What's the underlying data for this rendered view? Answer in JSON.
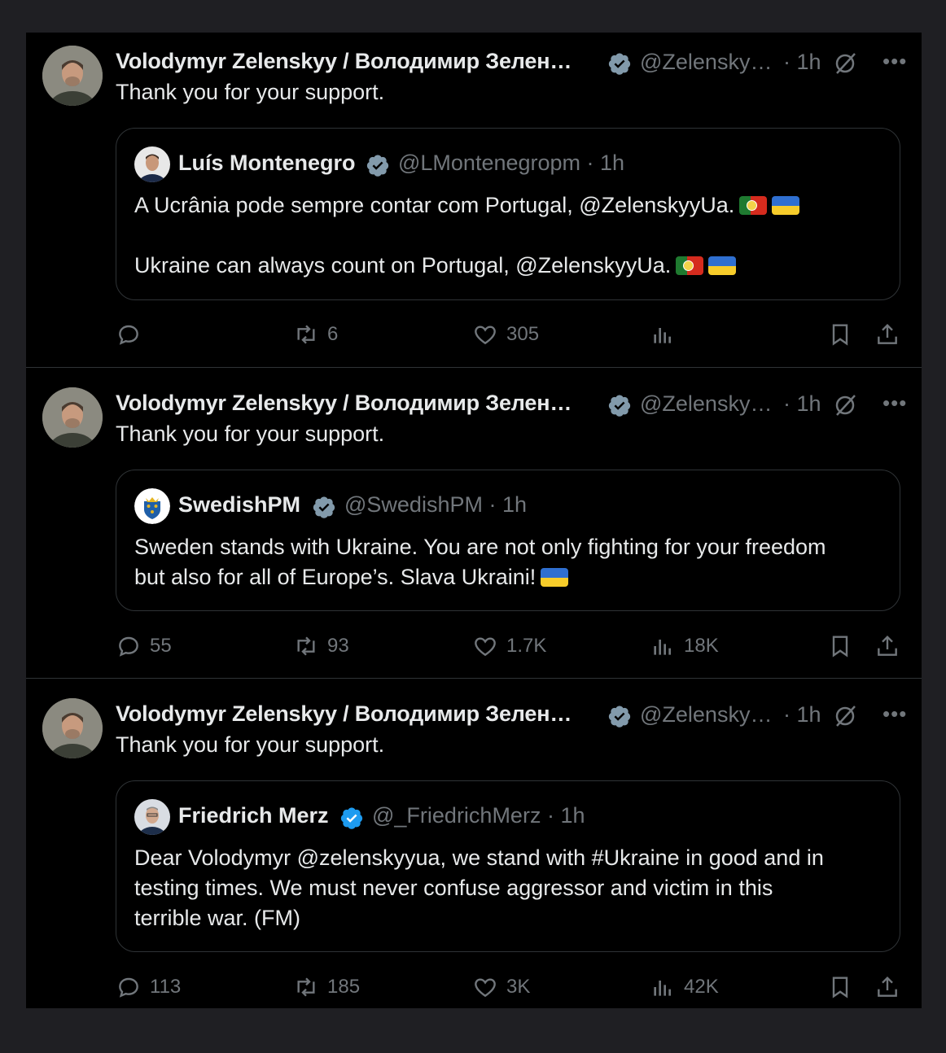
{
  "tweets": [
    {
      "author": "Volodymyr Zelenskyy / Володимир Зелен…",
      "handle": "@Zelensky…",
      "time": "· 1h",
      "more": "•••",
      "text": "Thank you for your support.",
      "quote": {
        "author": "Luís Montenegro",
        "handle": "@LMontenegropm · 1h",
        "verified_color": "#829aab",
        "lines": [
          "A Ucrânia pode sempre contar com Portugal, @ZelenskyyUa.",
          "",
          "Ukraine can always count on Portugal, @ZelenskyyUa."
        ]
      },
      "actions": {
        "replies": "",
        "reposts": "6",
        "likes": "305",
        "views": ""
      }
    },
    {
      "author": "Volodymyr Zelenskyy / Володимир Зелен…",
      "handle": "@Zelensky…",
      "time": "· 1h",
      "more": "•••",
      "text": "Thank you for your support.",
      "quote": {
        "author": "SwedishPM",
        "handle": "@SwedishPM · 1h",
        "verified_color": "#829aab",
        "lines": [
          "Sweden stands with Ukraine. You are not only fighting for your freedom",
          "but also for all of Europe’s. Slava Ukraini!"
        ]
      },
      "actions": {
        "replies": "55",
        "reposts": "93",
        "likes": "1.7K",
        "views": "18K"
      }
    },
    {
      "author": "Volodymyr Zelenskyy / Володимир Зелен…",
      "handle": "@Zelensky…",
      "time": "· 1h",
      "more": "•••",
      "text": "Thank you for your support.",
      "quote": {
        "author": "Friedrich Merz",
        "handle": "@_FriedrichMerz · 1h",
        "verified_color": "#1d9bf0",
        "lines": [
          "Dear Volodymyr @zelenskyyua, we stand with #Ukraine in good and in",
          "testing times. We must never confuse aggressor and victim in this",
          "terrible war. (FM)"
        ]
      },
      "actions": {
        "replies": "113",
        "reposts": "185",
        "likes": "3K",
        "views": "42K"
      }
    }
  ],
  "colors": {
    "background": "#000000",
    "outer": "#1f1f23",
    "muted": "#71767b",
    "border": "#2f3336",
    "verified_gray": "#829aab",
    "verified_blue": "#1d9bf0"
  },
  "icons": [
    "reply-icon",
    "repost-icon",
    "like-icon",
    "views-icon",
    "bookmark-icon",
    "share-icon",
    "grok-icon",
    "more-icon",
    "verified-badge-icon"
  ]
}
